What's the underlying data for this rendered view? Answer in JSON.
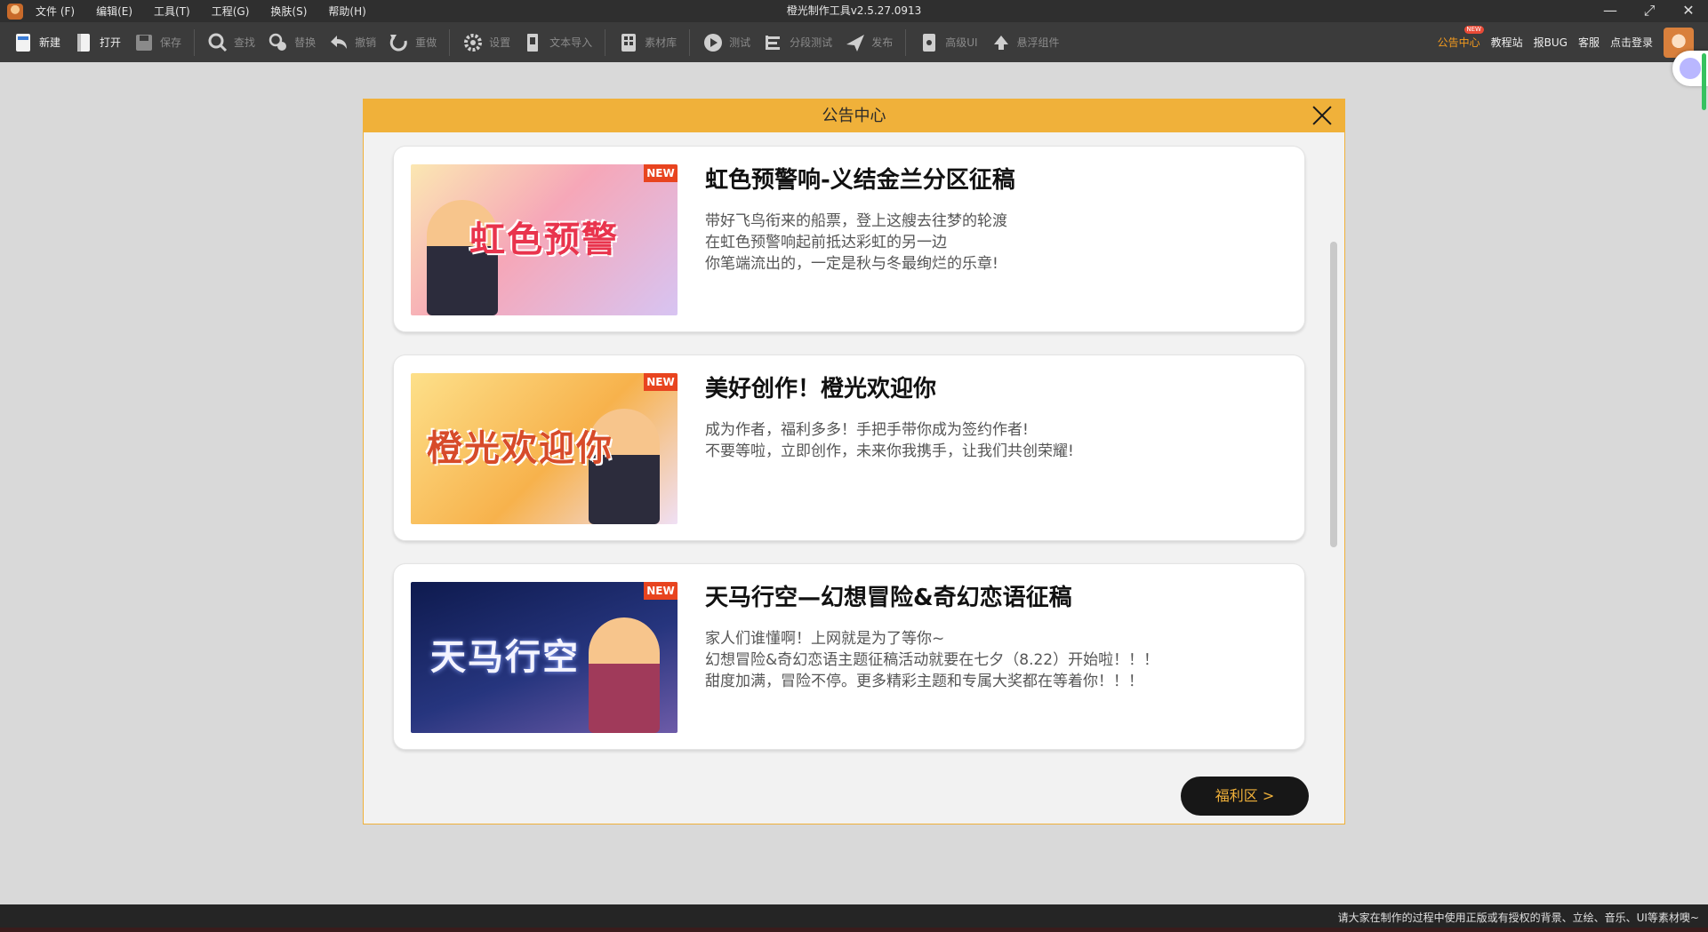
{
  "app": {
    "window_title": "橙光制作工具v2.5.27.0913",
    "menu": [
      "文件 (F)",
      "编辑(E)",
      "工具(T)",
      "工程(G)",
      "换肤(S)",
      "帮助(H)"
    ]
  },
  "toolbar": {
    "new": "新建",
    "open": "打开",
    "save": "保存",
    "find": "查找",
    "replace": "替换",
    "undo": "撤销",
    "redo": "重做",
    "settings": "设置",
    "text_import": "文本导入",
    "assets": "素材库",
    "test": "测试",
    "branch_test": "分段测试",
    "publish": "发布",
    "advanced_ui": "高级UI",
    "float_component": "悬浮组件",
    "right_links": {
      "announcements": "公告中心",
      "tutorials": "教程站",
      "report_bug": "报BUG",
      "support": "客服",
      "login": "点击登录"
    },
    "new_badge": "NEW"
  },
  "modal": {
    "title": "公告中心",
    "welfare_button": "福利区 >",
    "cards": [
      {
        "badge": "NEW",
        "image_caption": "虹色预警",
        "title": "虹色预警响-义结金兰分区征稿",
        "lines": [
          "带好飞鸟衔来的船票，登上这艘去往梦的轮渡",
          "在虹色预警响起前抵达彩虹的另一边",
          "你笔端流出的，一定是秋与冬最绚烂的乐章!"
        ]
      },
      {
        "badge": "NEW",
        "image_caption": "橙光欢迎你",
        "title": "美好创作！橙光欢迎你",
        "lines": [
          "成为作者，福利多多！手把手带你成为签约作者!",
          "不要等啦，立即创作，未来你我携手，让我们共创荣耀!"
        ]
      },
      {
        "badge": "NEW",
        "image_caption": "天马行空",
        "title": "天马行空—幻想冒险&奇幻恋语征稿",
        "lines": [
          "家人们谁懂啊！上网就是为了等你~",
          "幻想冒险&奇幻恋语主题征稿活动就要在七夕（8.22）开始啦！！！",
          "甜度加满，冒险不停。更多精彩主题和专属大奖都在等着你！！！"
        ]
      }
    ]
  },
  "statusbar": {
    "text": "请大家在制作的过程中使用正版或有授权的背景、立绘、音乐、UI等素材噢~"
  },
  "colors": {
    "accent": "#f0b13a",
    "toolbar_bg": "#3b3b3b",
    "titlebar_bg": "#2f2f2f",
    "active_link": "#f39a1e",
    "new_badge": "#e8441f"
  }
}
